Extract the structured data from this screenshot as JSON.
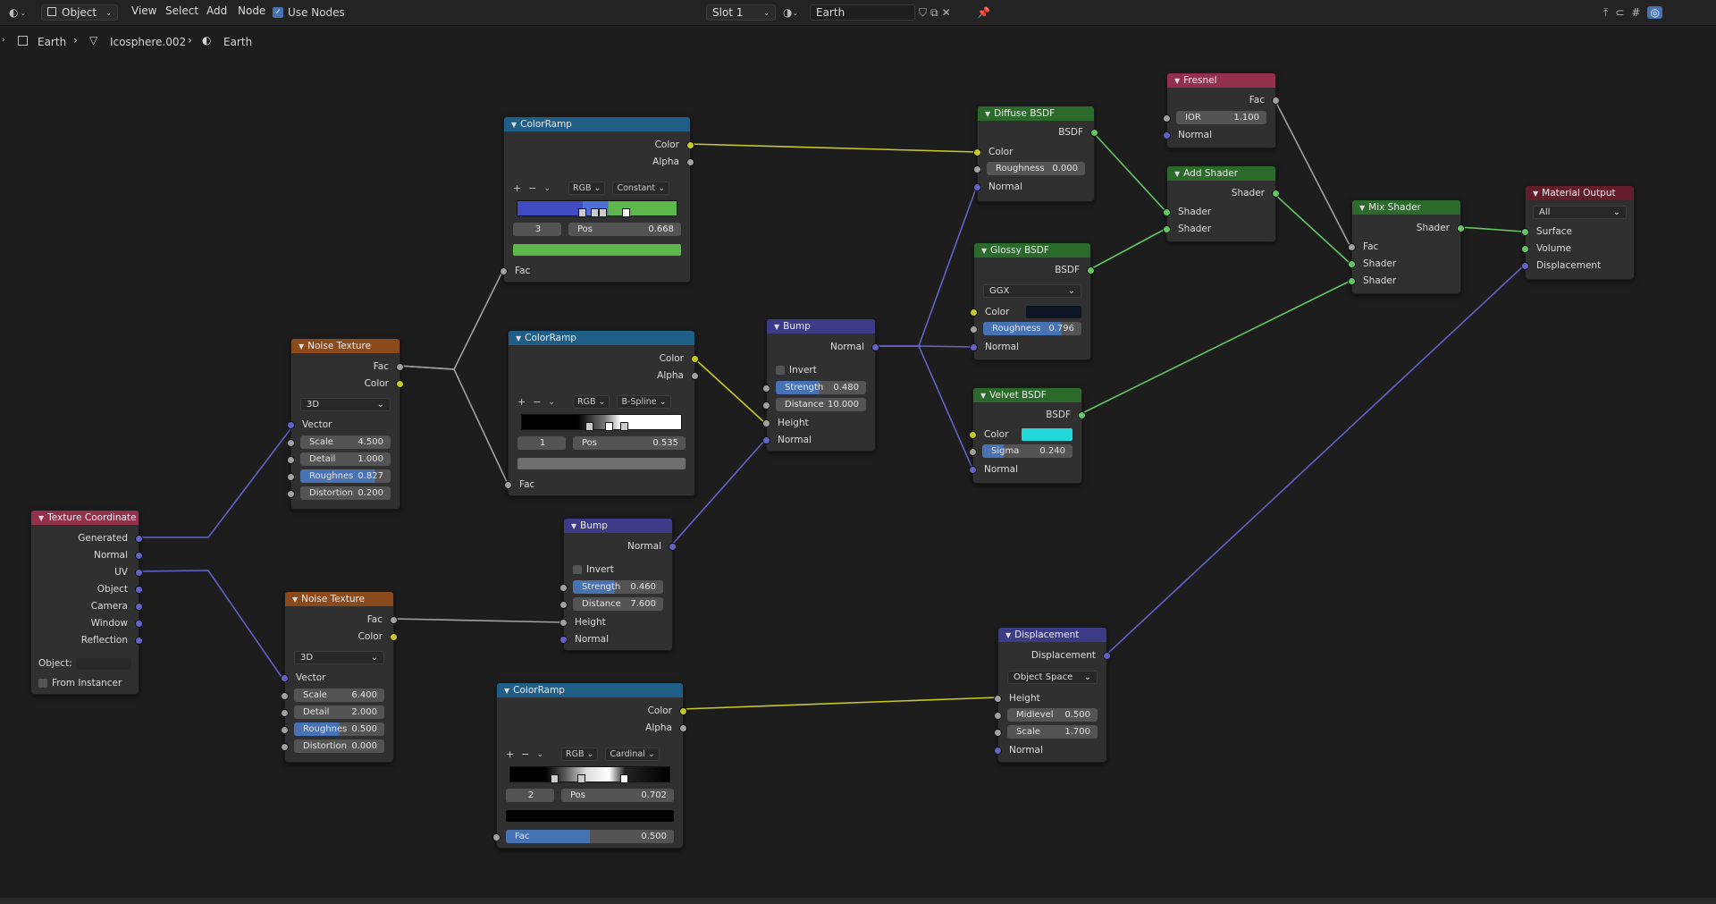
{
  "header": {
    "mode": "Object",
    "menus": [
      "View",
      "Select",
      "Add",
      "Node"
    ],
    "use_nodes_label": "Use Nodes",
    "slot": "Slot 1",
    "material_name": "Earth"
  },
  "breadcrumb": {
    "object": "Earth",
    "mesh": "Icosphere.002",
    "material": "Earth"
  },
  "nodes": {
    "texcoord": {
      "title": "Texture Coordinate",
      "outputs": [
        "Generated",
        "Normal",
        "UV",
        "Object",
        "Camera",
        "Window",
        "Reflection"
      ],
      "object_label": "Object:",
      "from_instancer": "From Instancer"
    },
    "noise1": {
      "title": "Noise Texture",
      "out_fac": "Fac",
      "out_color": "Color",
      "dim": "3D",
      "vector": "Vector",
      "scale_l": "Scale",
      "scale_v": "4.500",
      "detail_l": "Detail",
      "detail_v": "1.000",
      "rough_l": "Roughnes",
      "rough_v": "0.827",
      "dist_l": "Distortion",
      "dist_v": "0.200"
    },
    "noise2": {
      "title": "Noise Texture",
      "out_fac": "Fac",
      "out_color": "Color",
      "dim": "3D",
      "vector": "Vector",
      "scale_l": "Scale",
      "scale_v": "6.400",
      "detail_l": "Detail",
      "detail_v": "2.000",
      "rough_l": "Roughnes",
      "rough_v": "0.500",
      "dist_l": "Distortion",
      "dist_v": "0.000"
    },
    "ramp1": {
      "title": "ColorRamp",
      "color": "Color",
      "alpha": "Alpha",
      "mode": "RGB",
      "interp": "Constant",
      "index": "3",
      "pos_l": "Pos",
      "pos_v": "0.668",
      "fac": "Fac",
      "swatch": "#5cb84b"
    },
    "ramp2": {
      "title": "ColorRamp",
      "color": "Color",
      "alpha": "Alpha",
      "mode": "RGB",
      "interp": "B-Spline",
      "index": "1",
      "pos_l": "Pos",
      "pos_v": "0.535",
      "fac": "Fac",
      "swatch": "#6e6e6e"
    },
    "ramp3": {
      "title": "ColorRamp",
      "color": "Color",
      "alpha": "Alpha",
      "mode": "RGB",
      "interp": "Cardinal",
      "index": "2",
      "pos_l": "Pos",
      "pos_v": "0.702",
      "fac_l": "Fac",
      "fac_v": "0.500",
      "fac_fraction": 0.5,
      "swatch": "#000000"
    },
    "bump1": {
      "title": "Bump",
      "normal_out": "Normal",
      "invert": "Invert",
      "strength_l": "Strength",
      "strength_v": "0.480",
      "distance_l": "Distance",
      "distance_v": "10.000",
      "height": "Height",
      "normal_in": "Normal"
    },
    "bump2": {
      "title": "Bump",
      "normal_out": "Normal",
      "invert": "Invert",
      "strength_l": "Strength",
      "strength_v": "0.460",
      "distance_l": "Distance",
      "distance_v": "7.600",
      "height": "Height",
      "normal_in": "Normal"
    },
    "diffuse": {
      "title": "Diffuse BSDF",
      "out": "BSDF",
      "color": "Color",
      "rough_l": "Roughness",
      "rough_v": "0.000",
      "normal": "Normal"
    },
    "glossy": {
      "title": "Glossy BSDF",
      "out": "BSDF",
      "dist": "GGX",
      "color": "Color",
      "rough_l": "Roughness",
      "rough_v": "0.796",
      "rough_fraction": 0.796,
      "normal": "Normal",
      "swatch": "#0d1426"
    },
    "velvet": {
      "title": "Velvet BSDF",
      "out": "BSDF",
      "color": "Color",
      "sigma_l": "Sigma",
      "sigma_v": "0.240",
      "sigma_fraction": 0.24,
      "normal": "Normal",
      "swatch": "#22d8d8"
    },
    "fresnel": {
      "title": "Fresnel",
      "fac": "Fac",
      "ior_l": "IOR",
      "ior_v": "1.100",
      "normal": "Normal"
    },
    "add": {
      "title": "Add Shader",
      "out": "Shader",
      "in1": "Shader",
      "in2": "Shader"
    },
    "mix": {
      "title": "Mix Shader",
      "out": "Shader",
      "fac": "Fac",
      "in1": "Shader",
      "in2": "Shader"
    },
    "output": {
      "title": "Material Output",
      "target": "All",
      "surface": "Surface",
      "volume": "Volume",
      "displacement": "Displacement"
    },
    "disp": {
      "title": "Displacement",
      "out": "Displacement",
      "space": "Object Space",
      "height": "Height",
      "mid_l": "Midlevel",
      "mid_v": "0.500",
      "scale_l": "Scale",
      "scale_v": "1.700",
      "normal": "Normal"
    }
  },
  "colors": {
    "header_texture": "#8a4a1c",
    "header_converter": "#1f5e86",
    "header_vector": "#3b3b87",
    "header_shader": "#2c6a2c",
    "header_input": "#93304c",
    "header_output": "#631d2a"
  }
}
